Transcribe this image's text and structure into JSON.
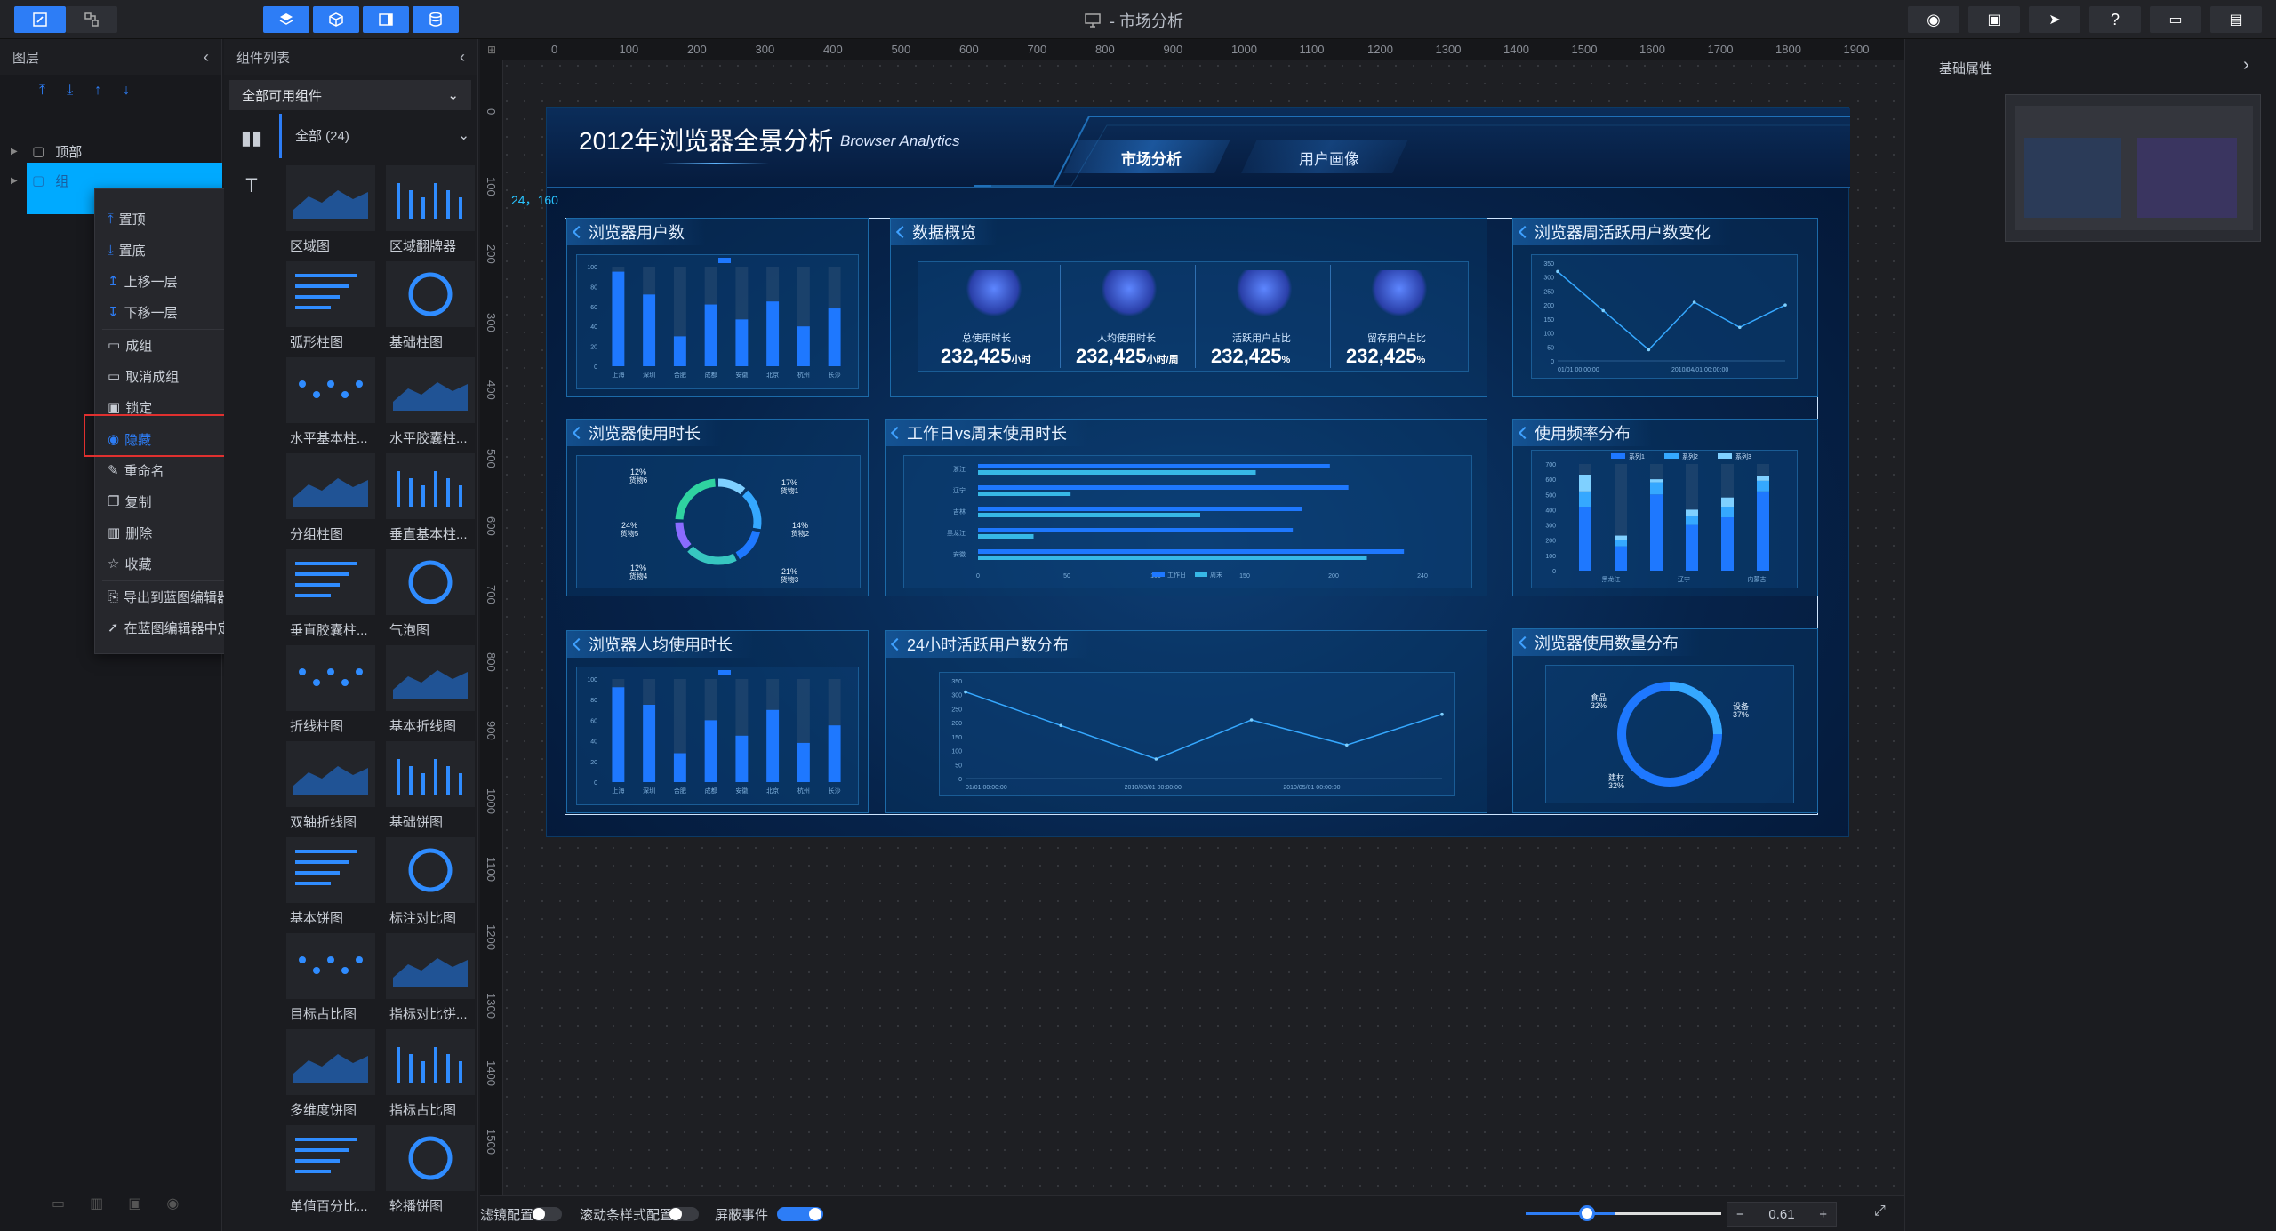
{
  "app": {
    "title": "- 市场分析"
  },
  "layers": {
    "title": "图层",
    "items": [
      "顶部",
      "组"
    ]
  },
  "context_menu": {
    "items": [
      "置顶",
      "置底",
      "上移一层",
      "下移一层",
      "成组",
      "取消成组",
      "锁定",
      "隐藏",
      "重命名",
      "复制",
      "删除",
      "收藏",
      "导出到蓝图编辑器",
      "在蓝图编辑器中定位"
    ],
    "highlighted": "隐藏"
  },
  "components": {
    "title": "组件列表",
    "filter": "全部可用组件",
    "category_count": "全部 (24)",
    "cards": [
      "区域图",
      "区域翻牌器",
      "弧形柱图",
      "基础柱图",
      "水平基本柱...",
      "水平胶囊柱...",
      "分组柱图",
      "垂直基本柱...",
      "垂直胶囊柱...",
      "气泡图",
      "折线柱图",
      "基本折线图",
      "双轴折线图",
      "基础饼图",
      "基本饼图",
      "标注对比图",
      "目标占比图",
      "指标对比饼...",
      "多维度饼图",
      "指标占比图",
      "单值百分比...",
      "轮播饼图"
    ]
  },
  "ruler": {
    "top": [
      "0",
      "100",
      "200",
      "300",
      "400",
      "500",
      "600",
      "700",
      "800",
      "900",
      "1000",
      "1100",
      "1200",
      "1300",
      "1400",
      "1500",
      "1600",
      "1700",
      "1800",
      "1900"
    ],
    "left": [
      "0",
      "100",
      "200",
      "300",
      "400",
      "500",
      "600",
      "700",
      "800",
      "900",
      "1000",
      "1100",
      "1200",
      "1300",
      "1400",
      "1500"
    ]
  },
  "selection_coord": "24，160",
  "dashboard": {
    "title": "2012年浏览器全景分析",
    "subtitle": "Browser Analytics",
    "tabs": [
      "市场分析",
      "用户画像"
    ],
    "panels": {
      "users": "浏览器用户数",
      "overview": "数据概览",
      "weekly": "浏览器周活跃用户数变化",
      "usage_time": "浏览器使用时长",
      "weekday": "工作日vs周末使用时长",
      "frequency": "使用频率分布",
      "avg_time": "浏览器人均使用时长",
      "hourly": "24小时活跃用户数分布",
      "count": "浏览器使用数量分布"
    },
    "kpis": [
      {
        "label": "总使用时长",
        "value": "232,425",
        "unit": "小时"
      },
      {
        "label": "人均使用时长",
        "value": "232,425",
        "unit": "小时/周"
      },
      {
        "label": "活跃用户占比",
        "value": "232,425",
        "unit": "%"
      },
      {
        "label": "留存用户占比",
        "value": "232,425",
        "unit": "%"
      }
    ],
    "bar_categories": [
      "上海",
      "深圳",
      "合肥",
      "成都",
      "安徽",
      "北京",
      "杭州",
      "长沙"
    ],
    "bar_axis": [
      "100",
      "80",
      "60",
      "40",
      "20",
      "0"
    ],
    "bar_values": [
      95,
      72,
      30,
      62,
      47,
      65,
      40,
      58
    ],
    "weekly_axis": [
      "350",
      "300",
      "250",
      "200",
      "150",
      "100",
      "50",
      "0"
    ],
    "weekly_x": [
      "01/01 00:00:00",
      "2010/04/01 00:00:00"
    ],
    "weekly_values": [
      320,
      180,
      40,
      210,
      120,
      200
    ],
    "donut_labels": [
      "12% 货物6",
      "17% 货物1",
      "24% 货物5",
      "14% 货物2",
      "12% 货物4",
      "21% 货物3"
    ],
    "weekday_categories": [
      "浙江",
      "辽宁",
      "吉林",
      "黑龙江",
      "安徽"
    ],
    "weekday_series": [
      {
        "name": "工作日",
        "values": [
          190,
          200,
          175,
          170,
          230
        ]
      },
      {
        "name": "周末",
        "values": [
          150,
          50,
          120,
          30,
          210
        ]
      }
    ],
    "weekday_axis": [
      "0",
      "50",
      "100",
      "150",
      "200",
      "240"
    ],
    "freq_axis": [
      "700",
      "600",
      "500",
      "400",
      "300",
      "200",
      "100",
      "0"
    ],
    "freq_legend": [
      "系列1",
      "系列2",
      "系列3"
    ],
    "freq_x": [
      "黑龙江",
      "辽宁",
      "内蒙古"
    ],
    "avg_bar_values": [
      92,
      75,
      28,
      60,
      45,
      70,
      38,
      55
    ],
    "hourly_axis": [
      "350",
      "300",
      "250",
      "200",
      "150",
      "100",
      "50",
      "0"
    ],
    "hourly_x": [
      "01/01 00:00:00",
      "2010/03/01 00:00:00",
      "2010/05/01 00:00:00"
    ],
    "hourly_values": [
      310,
      190,
      70,
      210,
      120,
      230
    ],
    "count_labels": [
      "食品 32%",
      "设备 37%",
      "建材 32%"
    ]
  },
  "right": {
    "title": "基础属性"
  },
  "bottom": {
    "toggles": [
      "滤镜配置",
      "滚动条样式配置",
      "屏蔽事件"
    ],
    "zoom": "0.61"
  },
  "colors": {
    "accent": "#2d7df6",
    "selected_layer": "#00aaff",
    "dash_bg": "#06234a",
    "bar": "#1e78ff"
  }
}
